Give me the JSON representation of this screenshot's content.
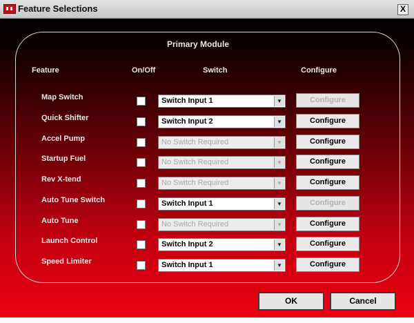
{
  "window": {
    "title": "Feature Selections",
    "close_glyph": "X"
  },
  "group_label": "Primary Module",
  "headers": {
    "feature": "Feature",
    "onoff": "On/Off",
    "switch": "Switch",
    "configure": "Configure"
  },
  "rows": [
    {
      "feature": "Map Switch",
      "checked": false,
      "switch": "Switch Input 1",
      "switch_enabled": true,
      "configure": "Configure",
      "configure_enabled": false
    },
    {
      "feature": "Quick Shifter",
      "checked": false,
      "switch": "Switch Input 2",
      "switch_enabled": true,
      "configure": "Configure",
      "configure_enabled": true
    },
    {
      "feature": "Accel Pump",
      "checked": false,
      "switch": "No Switch Required",
      "switch_enabled": false,
      "configure": "Configure",
      "configure_enabled": true
    },
    {
      "feature": "Startup Fuel",
      "checked": false,
      "switch": "No Switch Required",
      "switch_enabled": false,
      "configure": "Configure",
      "configure_enabled": true
    },
    {
      "feature": "Rev X-tend",
      "checked": false,
      "switch": "No Switch Required",
      "switch_enabled": false,
      "configure": "Configure",
      "configure_enabled": true
    },
    {
      "feature": "Auto Tune Switch",
      "checked": false,
      "switch": "Switch Input 1",
      "switch_enabled": true,
      "configure": "Configure",
      "configure_enabled": false
    },
    {
      "feature": "Auto Tune",
      "checked": false,
      "switch": "No Switch Required",
      "switch_enabled": false,
      "configure": "Configure",
      "configure_enabled": true
    },
    {
      "feature": "Launch Control",
      "checked": false,
      "switch": "Switch Input 2",
      "switch_enabled": true,
      "configure": "Configure",
      "configure_enabled": true
    },
    {
      "feature": "Speed Limiter",
      "checked": false,
      "switch": "Switch Input 1",
      "switch_enabled": true,
      "configure": "Configure",
      "configure_enabled": true
    }
  ],
  "buttons": {
    "ok": "OK",
    "cancel": "Cancel"
  },
  "colors": {
    "background_top": "#000000",
    "background_bottom": "#f00010",
    "text": "#e8e8e8"
  }
}
